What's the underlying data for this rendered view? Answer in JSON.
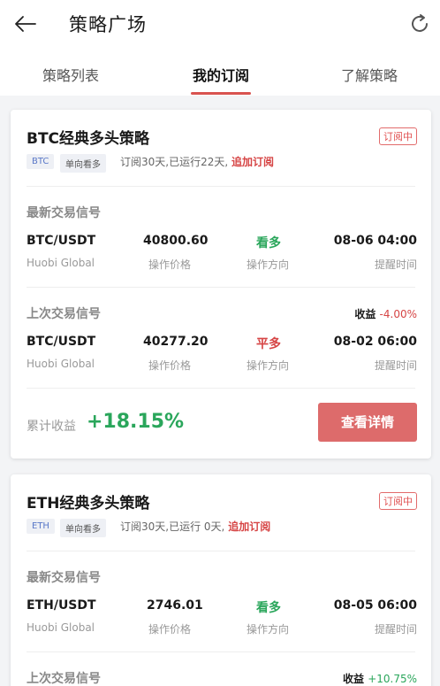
{
  "header": {
    "title": "策略广场"
  },
  "tabs": [
    {
      "label": "策略列表"
    },
    {
      "label": "我的订阅"
    },
    {
      "label": "了解策略"
    }
  ],
  "cards": [
    {
      "name": "BTC经典多头策略",
      "status": "订阅中",
      "tag_coin": "BTC",
      "tag_dir": "单向看多",
      "meta": "订阅30天,已运行22天,",
      "add_label": "追加订阅",
      "latest_title": "最新交易信号",
      "latest": {
        "pair": "BTC/USDT",
        "exchange": "Huobi Global",
        "price": "40800.60",
        "price_label": "操作价格",
        "direction": "看多",
        "direction_label": "操作方向",
        "time": "08-06 04:00",
        "time_label": "提醒时间"
      },
      "prev_title": "上次交易信号",
      "profit_label": "收益",
      "profit_value": "-4.00%",
      "prev": {
        "pair": "BTC/USDT",
        "exchange": "Huobi Global",
        "price": "40277.20",
        "price_label": "操作价格",
        "direction": "平多",
        "direction_label": "操作方向",
        "time": "08-02 06:00",
        "time_label": "提醒时间"
      },
      "cum_label": "累计收益",
      "cum_value": "+18.15%",
      "detail_btn": "查看详情"
    },
    {
      "name": "ETH经典多头策略",
      "status": "订阅中",
      "tag_coin": "ETH",
      "tag_dir": "单向看多",
      "meta": "订阅30天,已运行 0天,",
      "add_label": "追加订阅",
      "latest_title": "最新交易信号",
      "latest": {
        "pair": "ETH/USDT",
        "exchange": "Huobi Global",
        "price": "2746.01",
        "price_label": "操作价格",
        "direction": "看多",
        "direction_label": "操作方向",
        "time": "08-05 06:00",
        "time_label": "提醒时间"
      },
      "prev_title": "上次交易信号",
      "profit_label": "收益",
      "profit_value": "+10.75%"
    }
  ],
  "colors": {
    "accent": "#dd6b6b",
    "up": "#2aa65b",
    "down": "#d64545"
  }
}
